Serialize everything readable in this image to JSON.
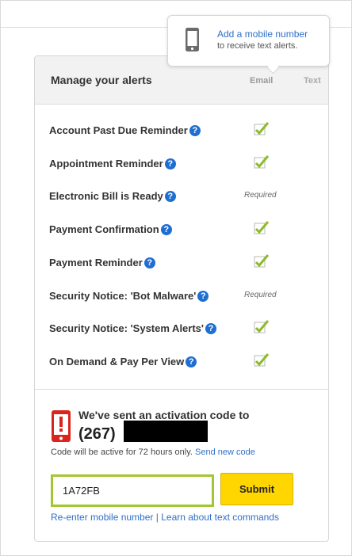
{
  "tooltip": {
    "link_text": "Add a mobile number",
    "subtext": "to receive text alerts."
  },
  "card": {
    "title": "Manage your alerts",
    "columns": {
      "email": "Email",
      "text": "Text"
    }
  },
  "alerts": [
    {
      "label": "Account Past Due Reminder",
      "status": "check"
    },
    {
      "label": "Appointment Reminder",
      "status": "check"
    },
    {
      "label": "Electronic Bill is Ready",
      "status": "required",
      "status_text": "Required"
    },
    {
      "label": "Payment Confirmation",
      "status": "check"
    },
    {
      "label": "Payment Reminder",
      "status": "check"
    },
    {
      "label": "Security Notice: 'Bot Malware'",
      "status": "required",
      "status_text": "Required"
    },
    {
      "label": "Security Notice: 'System Alerts'",
      "status": "check"
    },
    {
      "label": "On Demand & Pay Per View",
      "status": "check"
    }
  ],
  "help_glyph": "?",
  "activation": {
    "message": "We've sent an activation code to",
    "phone_prefix": "(267)",
    "note": "Code will be active for 72 hours only.",
    "send_new_link": "Send new code",
    "code_value": "1A72FB",
    "submit_label": "Submit",
    "reenter_link": "Re-enter mobile number",
    "separator": "|",
    "learn_link": "Learn about text commands"
  },
  "colors": {
    "accent_green": "#a3c633",
    "submit_yellow": "#ffd600",
    "phone_red": "#d9251d",
    "link_blue": "#2f6fc8"
  },
  "icons": {
    "check": "check-icon",
    "help": "help-icon",
    "phone_alert": "mobile-alert-icon",
    "phone": "mobile-phone-icon"
  }
}
